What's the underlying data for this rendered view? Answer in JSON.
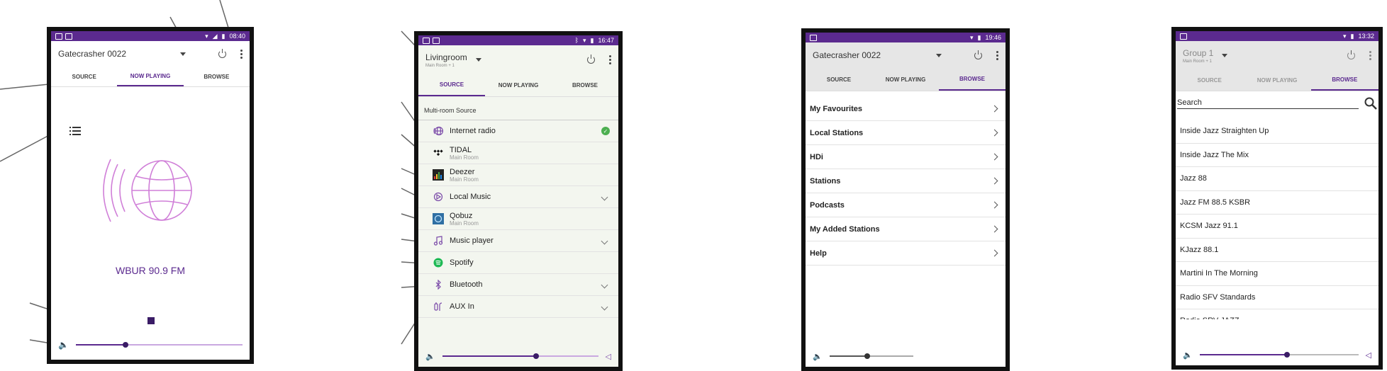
{
  "colors": {
    "accent": "#5b2a8f",
    "status_bar": "#5b2a8f",
    "spotify": "#1db954",
    "check": "#4caf50"
  },
  "screens": [
    {
      "status": {
        "time": "08:40"
      },
      "device_name": "Gatecrasher 0022",
      "tabs": [
        "SOURCE",
        "NOW PLAYING",
        "BROWSE"
      ],
      "active_tab": 1,
      "now_playing": {
        "station": "WBUR 90.9 FM",
        "volume": 0.3
      }
    },
    {
      "status": {
        "time": "16:47"
      },
      "room_name": "Livingroom",
      "room_sub": "Main Room + 1",
      "tabs": [
        "SOURCE",
        "NOW PLAYING",
        "BROWSE"
      ],
      "active_tab": 0,
      "section_label": "Multi-room Source",
      "sources": [
        {
          "label": "Internet radio",
          "sub": "",
          "icon": "globe-icon",
          "trail": "check"
        },
        {
          "label": "TIDAL",
          "sub": "Main Room",
          "icon": "tidal-icon",
          "trail": ""
        },
        {
          "label": "Deezer",
          "sub": "Main Room",
          "icon": "deezer-icon",
          "trail": ""
        },
        {
          "label": "Local Music",
          "sub": "",
          "icon": "music-folder-icon",
          "trail": "chevron"
        },
        {
          "label": "Qobuz",
          "sub": "Main Room",
          "icon": "qobuz-icon",
          "trail": ""
        },
        {
          "label": "Music player",
          "sub": "",
          "icon": "music-note-icon",
          "trail": "chevron"
        },
        {
          "label": "Spotify",
          "sub": "",
          "icon": "spotify-icon",
          "trail": ""
        },
        {
          "label": "Bluetooth",
          "sub": "",
          "icon": "bluetooth-icon",
          "trail": "chevron"
        },
        {
          "label": "AUX In",
          "sub": "",
          "icon": "aux-icon",
          "trail": "chevron"
        }
      ],
      "volume": 0.6
    },
    {
      "status": {
        "time": "19:46"
      },
      "device_name": "Gatecrasher 0022",
      "tabs": [
        "SOURCE",
        "NOW PLAYING",
        "BROWSE"
      ],
      "active_tab": 2,
      "menu": [
        "My Favourites",
        "Local Stations",
        "HDi",
        "Stations",
        "Podcasts",
        "My Added Stations",
        "Help"
      ],
      "volume": 0.45
    },
    {
      "status": {
        "time": "13:32"
      },
      "room_name": "Group 1",
      "room_sub": "Main Room + 1",
      "tabs": [
        "SOURCE",
        "NOW PLAYING",
        "BROWSE"
      ],
      "active_tab": 2,
      "search_label": "Search",
      "results": [
        "Inside Jazz Straighten Up",
        "Inside Jazz The Mix",
        "Jazz 88",
        "Jazz FM 88.5 KSBR",
        "KCSM Jazz 91.1",
        "KJazz 88.1",
        "Martini In The Morning",
        "Radio SFV Standards",
        "Radio SRV JAZZ"
      ],
      "volume": 0.55
    }
  ]
}
